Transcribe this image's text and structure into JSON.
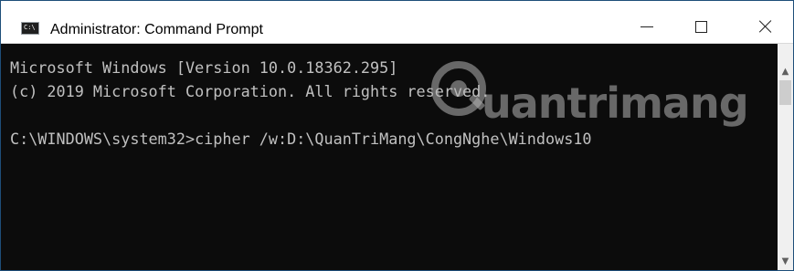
{
  "window": {
    "title": "Administrator: Command Prompt",
    "icon": "cmd-icon",
    "icon_text": "C:\\",
    "controls": {
      "minimize_icon": "minimize-icon",
      "maximize_icon": "maximize-icon",
      "close_icon": "close-icon"
    }
  },
  "console": {
    "lines": [
      "Microsoft Windows [Version 10.0.18362.295]",
      "(c) 2019 Microsoft Corporation. All rights reserved.",
      "C:\\WINDOWS\\system32>cipher /w:D:\\QuanTriMang\\CongNghe\\Windows10"
    ],
    "background_color": "#0c0c0c",
    "text_color": "#c0c0c0"
  },
  "watermark": {
    "text": "uantrimang"
  },
  "scrollbar": {
    "up_icon": "scroll-up-arrow-icon",
    "down_icon": "scroll-down-arrow-icon"
  }
}
